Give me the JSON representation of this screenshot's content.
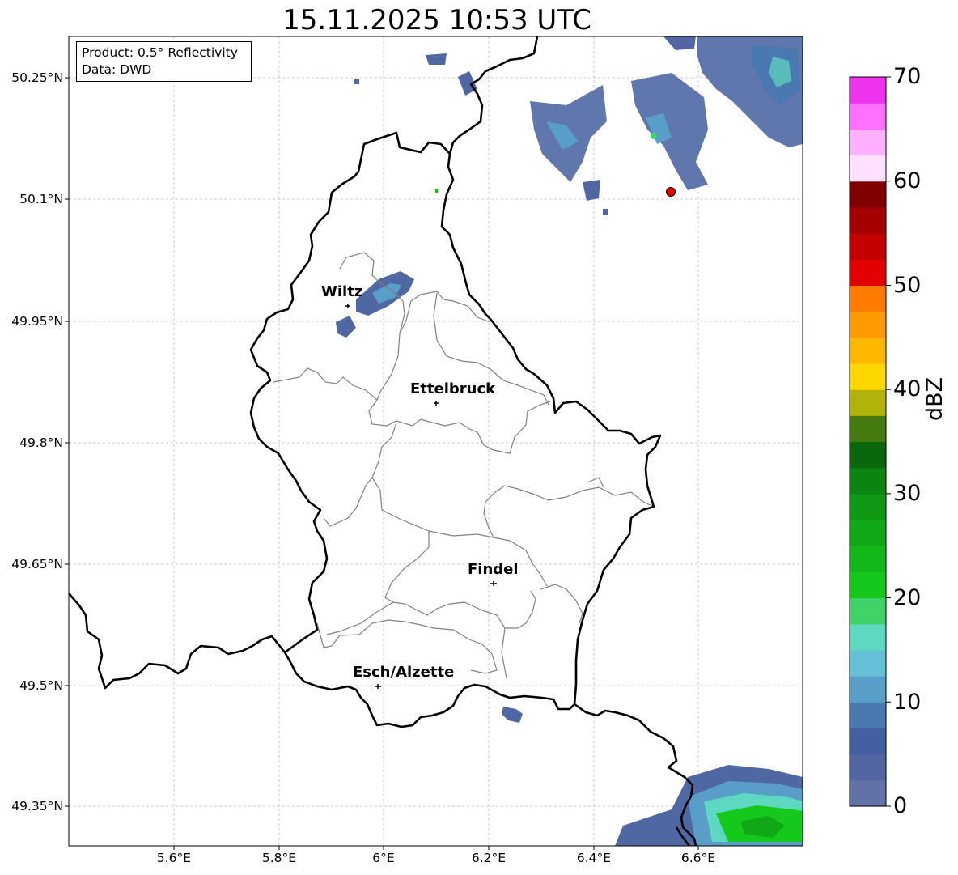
{
  "title": "15.11.2025 10:53 UTC",
  "info_box": {
    "product": "Product: 0.5° Reflectivity",
    "data": "Data: DWD"
  },
  "latitude_labels": [
    "50.25°N",
    "50.1°N",
    "49.95°N",
    "49.8°N",
    "49.65°N",
    "49.5°N",
    "49.35°N"
  ],
  "longitude_labels": [
    "5.6°E",
    "5.8°E",
    "6°E",
    "6.2°E",
    "6.4°E",
    "6.6°E"
  ],
  "cities": [
    {
      "name": "Wiltz",
      "lon": 5.94,
      "lat": 49.966
    },
    {
      "name": "Ettelbruck",
      "lon": 6.104,
      "lat": 49.848
    },
    {
      "name": "Findel",
      "lon": 6.211,
      "lat": 49.626
    },
    {
      "name": "Esch/Alzette",
      "lon": 5.99,
      "lat": 49.5
    }
  ],
  "marker": {
    "lon": 6.551,
    "lat": 50.111,
    "color": "#e00000"
  },
  "colorbar": {
    "label": "dBZ",
    "ticks": [
      "0",
      "10",
      "20",
      "30",
      "40",
      "50",
      "60",
      "70"
    ],
    "range": [
      0,
      70
    ],
    "step": 2.5,
    "colors": [
      "#6272a8",
      "#5366a3",
      "#445fa3",
      "#4a78b0",
      "#589ec8",
      "#65c0d8",
      "#5ed8c0",
      "#40d468",
      "#14c81c",
      "#12b81a",
      "#10a816",
      "#0e9814",
      "#0c8410",
      "#0a680c",
      "#457a10",
      "#b0b40a",
      "#ffd700",
      "#ffb800",
      "#ff9a00",
      "#ff7c00",
      "#e40000",
      "#c40000",
      "#a40000",
      "#800000",
      "#ffe0ff",
      "#ffb0ff",
      "#ff70ff",
      "#ee33ee"
    ]
  },
  "map": {
    "lon_range": [
      5.4,
      6.8
    ],
    "lat_range": [
      49.3,
      50.3
    ],
    "gridlines": true,
    "colors": {
      "border": "#000000",
      "cantons": "#808080",
      "grid": "#bbbbbb"
    }
  }
}
